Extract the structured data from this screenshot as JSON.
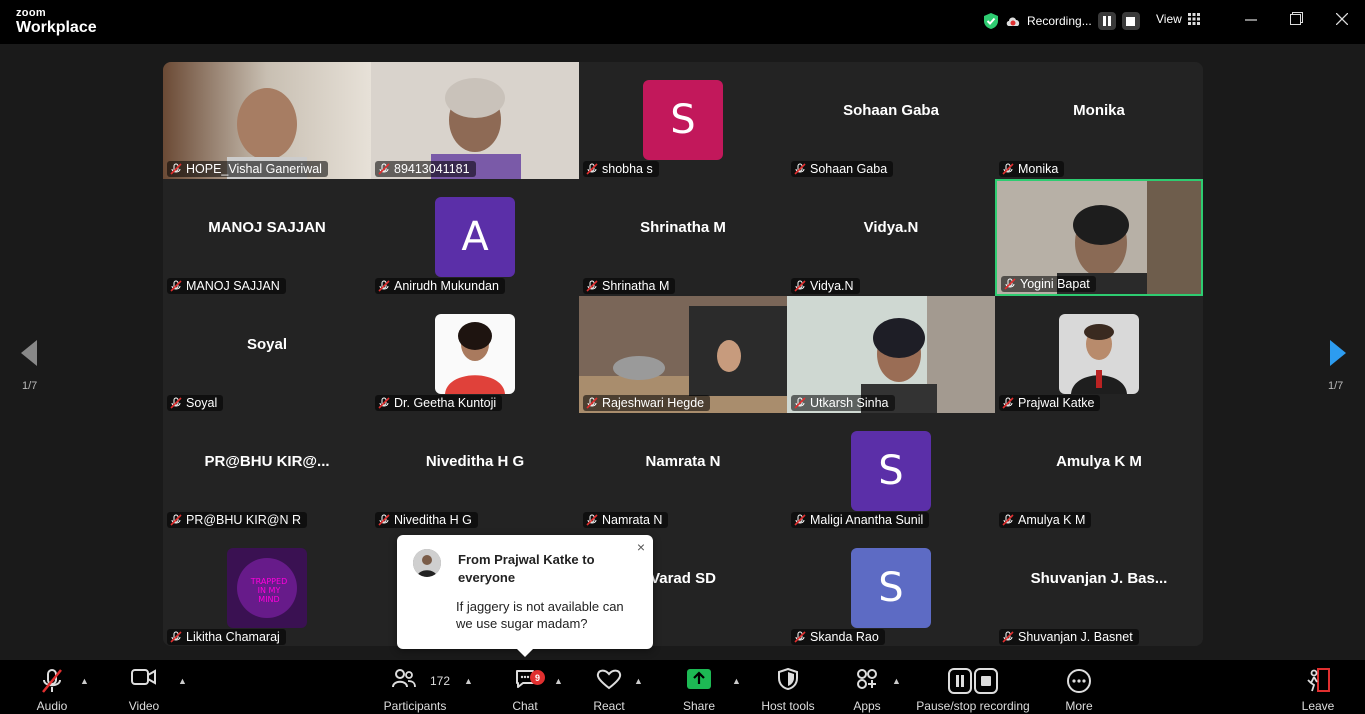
{
  "app": {
    "brand_top": "zoom",
    "brand_bottom": "Workplace"
  },
  "topbar": {
    "recording_label": "Recording...",
    "view_label": "View"
  },
  "page_indicator": {
    "left": "1/7",
    "right": "1/7"
  },
  "tiles": [
    {
      "display": "HOPE_Vishal Ganeriwal",
      "label": "HOPE_Vishal Ganeriwal",
      "kind": "video"
    },
    {
      "display": "89413041181",
      "label": "89413041181",
      "kind": "video"
    },
    {
      "display": "S",
      "label": "shobha s",
      "kind": "avatar",
      "color": "#c2185b"
    },
    {
      "display": "Sohaan Gaba",
      "label": "Sohaan Gaba",
      "kind": "name"
    },
    {
      "display": "Monika",
      "label": "Monika",
      "kind": "name"
    },
    {
      "display": "MANOJ SAJJAN",
      "label": "MANOJ SAJJAN",
      "kind": "name"
    },
    {
      "display": "A",
      "label": "Anirudh Mukundan",
      "kind": "avatar",
      "color": "#5b2fa8"
    },
    {
      "display": "Shrinatha M",
      "label": "Shrinatha M",
      "kind": "name"
    },
    {
      "display": "Vidya.N",
      "label": "Vidya.N",
      "kind": "name"
    },
    {
      "display": "Yogini Bapat",
      "label": "Yogini Bapat",
      "kind": "video",
      "active": true
    },
    {
      "display": "Soyal",
      "label": "Soyal",
      "kind": "name"
    },
    {
      "display": "Dr. Geetha Kuntoji",
      "label": "Dr. Geetha Kuntoji",
      "kind": "photo"
    },
    {
      "display": "Rajeshwari Hegde",
      "label": "Rajeshwari Hegde",
      "kind": "video"
    },
    {
      "display": "Utkarsh Sinha",
      "label": "Utkarsh Sinha",
      "kind": "video"
    },
    {
      "display": "Prajwal Katke",
      "label": "Prajwal Katke",
      "kind": "photo"
    },
    {
      "display": "PR@BHU  KIR@...",
      "label": "PR@BHU KIR@N R",
      "kind": "name"
    },
    {
      "display": "Niveditha H G",
      "label": "Niveditha H G",
      "kind": "name"
    },
    {
      "display": "Namrata N",
      "label": "Namrata N",
      "kind": "name"
    },
    {
      "display": "S",
      "label": "Maligi Anantha Sunil",
      "kind": "avatar",
      "color": "#5b2fa8"
    },
    {
      "display": "Amulya K M",
      "label": "Amulya K M",
      "kind": "name"
    },
    {
      "display": "TRAPPED IN MY MIND",
      "label": "Likitha Chamaraj",
      "kind": "photo"
    },
    {
      "display": "",
      "label": "",
      "kind": "name"
    },
    {
      "display": "Varad SD",
      "label": "D",
      "kind": "name"
    },
    {
      "display": "S",
      "label": "Skanda Rao",
      "kind": "avatar",
      "color": "#5d6bc4"
    },
    {
      "display": "Shuvanjan J. Bas...",
      "label": "Shuvanjan J. Basnet",
      "kind": "name"
    }
  ],
  "chat_popup": {
    "from": "From Prajwal Katke to everyone",
    "message": "If jaggery is not available can we use sugar madam?",
    "close": "×"
  },
  "toolbar": {
    "audio": "Audio",
    "video": "Video",
    "participants": "Participants",
    "participants_count": "172",
    "chat": "Chat",
    "chat_badge": "9",
    "react": "React",
    "share": "Share",
    "host_tools": "Host tools",
    "apps": "Apps",
    "pause_stop": "Pause/stop recording",
    "more": "More",
    "leave": "Leave"
  },
  "colors": {
    "accent_green": "#2ecc71",
    "share_green": "#1db954",
    "badge_red": "#e02f2f",
    "nav_blue": "#2d9cf0"
  }
}
